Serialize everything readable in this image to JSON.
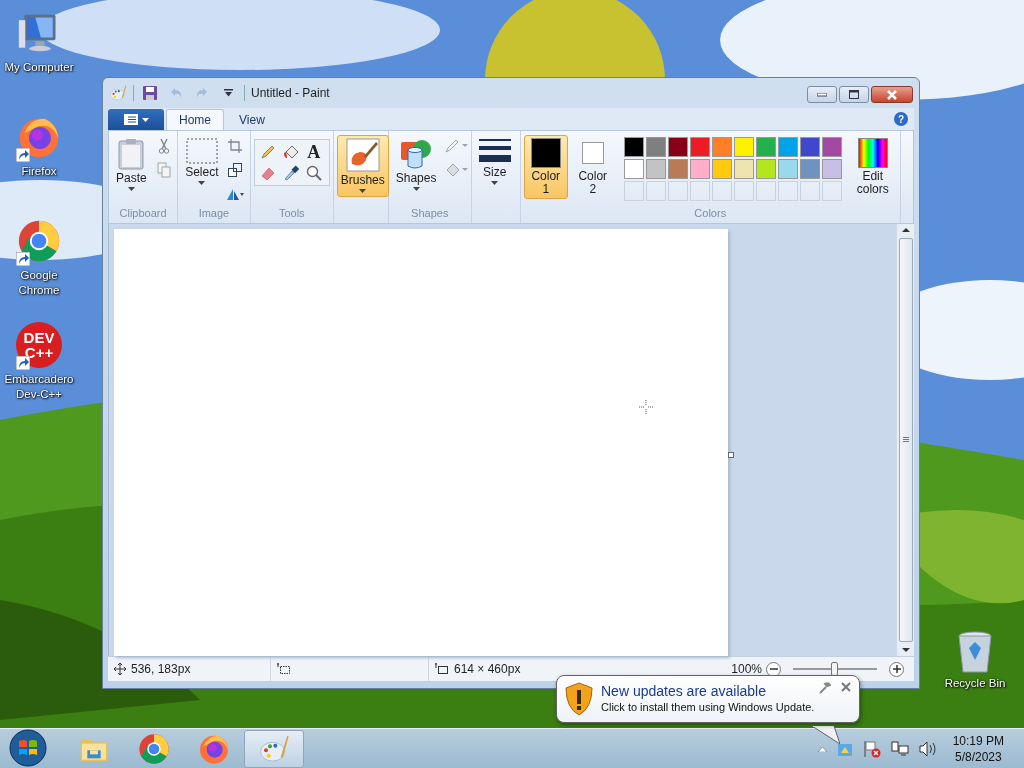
{
  "desktop_icons": [
    {
      "kind": "computer",
      "label": "My Computer",
      "shortcut": false
    },
    {
      "kind": "firefox",
      "label": "Firefox",
      "shortcut": true
    },
    {
      "kind": "chrome",
      "label": "Google Chrome",
      "shortcut": true
    },
    {
      "kind": "devcpp",
      "label": "Embarcadero Dev-C++",
      "shortcut": true,
      "logo_lines": [
        "DEV",
        "C++"
      ]
    }
  ],
  "recycle_bin": {
    "label": "Recycle Bin"
  },
  "window": {
    "title": "Untitled - Paint",
    "quick_access": [
      {
        "kind": "save",
        "disabled": false
      },
      {
        "kind": "undo",
        "disabled": true
      },
      {
        "kind": "redo",
        "disabled": true
      }
    ],
    "tabs": [
      {
        "label": "Home",
        "selected": true
      },
      {
        "label": "View",
        "selected": false
      }
    ],
    "help": "?",
    "ribbon": {
      "clipboard": {
        "label": "Clipboard",
        "paste": "Paste"
      },
      "image": {
        "label": "Image",
        "select": "Select"
      },
      "tools": {
        "label": "Tools",
        "text_glyph": "A"
      },
      "brushes": {
        "label": "Brushes",
        "selected": true
      },
      "shapes": {
        "label": "Shapes",
        "button": "Shapes"
      },
      "size": {
        "label": "Size"
      },
      "colors": {
        "label": "Colors",
        "edit": "Edit colors",
        "active": [
          {
            "label": "Color 1",
            "color": "#000000",
            "selected": true
          },
          {
            "label": "Color 2",
            "color": "#ffffff",
            "selected": false
          }
        ],
        "palette": [
          {
            "color": "#000000"
          },
          {
            "color": "#7f7f7f"
          },
          {
            "color": "#880015"
          },
          {
            "color": "#ed1c24"
          },
          {
            "color": "#ff7f27"
          },
          {
            "color": "#fff200"
          },
          {
            "color": "#22b14c"
          },
          {
            "color": "#00a2e8"
          },
          {
            "color": "#3f48cc"
          },
          {
            "color": "#a349a4"
          },
          {
            "color": "#ffffff"
          },
          {
            "color": "#c3c3c3"
          },
          {
            "color": "#b97a57"
          },
          {
            "color": "#ffaec9"
          },
          {
            "color": "#ffc90e"
          },
          {
            "color": "#efe4b0"
          },
          {
            "color": "#b5e61d"
          },
          {
            "color": "#99d9ea"
          },
          {
            "color": "#7092be"
          },
          {
            "color": "#c8bfe7"
          }
        ]
      }
    },
    "status_bar": {
      "cursor": "536, 183px",
      "canvas_size": "614 × 460px",
      "zoom": "100%",
      "zoom_slider": {
        "level": 0.5
      }
    }
  },
  "notification": {
    "title": "New updates are available",
    "body": "Click to install them using Windows Update."
  },
  "taskbar": {
    "items": [
      {
        "kind": "explorer",
        "selected": false
      },
      {
        "kind": "chrome",
        "selected": false
      },
      {
        "kind": "firefox",
        "selected": false
      },
      {
        "kind": "paint",
        "selected": true
      }
    ],
    "clock": {
      "time": "10:19 PM",
      "date": "5/8/2023"
    }
  }
}
